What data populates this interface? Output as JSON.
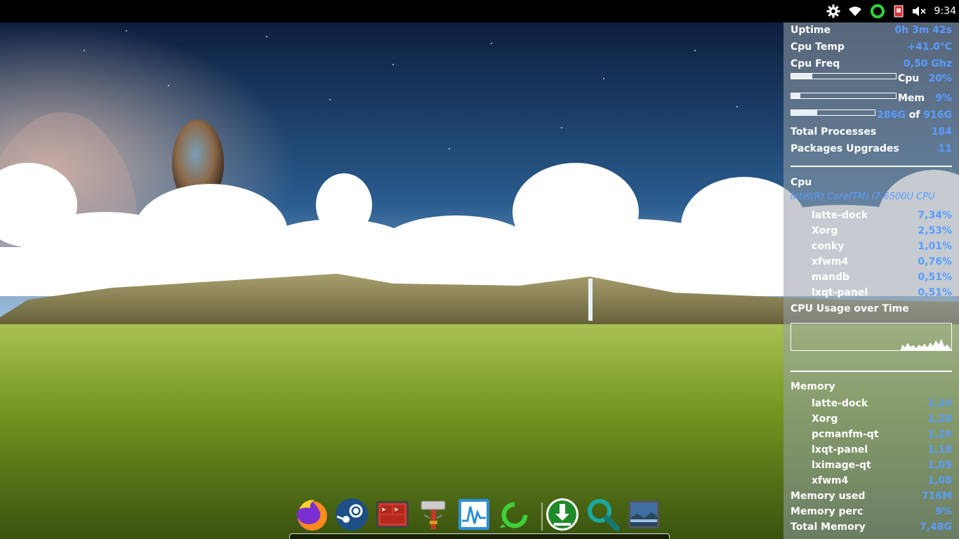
{
  "clock": "9:34",
  "tray": [
    {
      "icon": "gear-icon"
    },
    {
      "icon": "wifi-icon"
    },
    {
      "icon": "ring-status-icon"
    },
    {
      "icon": "phone-icon"
    },
    {
      "icon": "speaker-muted-icon"
    }
  ],
  "conky": {
    "uptime_label": "Uptime",
    "uptime_value": "0h 3m 42s",
    "cputemp_label": "Cpu Temp",
    "cputemp_value": "+41.0°C",
    "cpufreq_label": "Cpu Freq",
    "cpufreq_value": "0,50 Ghz",
    "cpu_bar_label": "Cpu",
    "cpu_bar_value": "20%",
    "cpu_bar_fraction": 0.2,
    "mem_bar_label": "Mem",
    "mem_bar_value": "9%",
    "mem_bar_fraction": 0.09,
    "disk_used": "286G",
    "disk_of": "of",
    "disk_total": "916G",
    "disk_fraction": 0.31,
    "processes_label": "Total Processes",
    "processes_value": "184",
    "upgrades_label": "Packages Upgrades",
    "upgrades_value": "11",
    "cpu_section": "Cpu",
    "cpu_model": "Intel(R) Core(TM) i7-6500U CPU",
    "cpu_procs": [
      {
        "name": "latte-dock",
        "value": "7,34%"
      },
      {
        "name": "Xorg",
        "value": "2,53%"
      },
      {
        "name": "conky",
        "value": "1,01%"
      },
      {
        "name": "xfwm4",
        "value": "0,76%"
      },
      {
        "name": "mandb",
        "value": "0,51%"
      },
      {
        "name": "lxqt-panel",
        "value": "0,51%"
      }
    ],
    "graph_title": "CPU Usage over Time",
    "memory_section": "Memory",
    "mem_procs": [
      {
        "name": "latte-dock",
        "value": "2,24"
      },
      {
        "name": "Xorg",
        "value": "1,28"
      },
      {
        "name": "pcmanfm-qt",
        "value": "1,26"
      },
      {
        "name": "lxqt-panel",
        "value": "1,18"
      },
      {
        "name": "lximage-qt",
        "value": "1,09"
      },
      {
        "name": "xfwm4",
        "value": "1,08"
      }
    ],
    "memused_label": "Memory used",
    "memused_value": "716M",
    "memperc_label": "Memory perc",
    "memperc_value": "9%",
    "memtotal_label": "Total Memory",
    "memtotal_value": "7,48G"
  },
  "dock": [
    {
      "icon": "firefox-icon"
    },
    {
      "icon": "steam-icon"
    },
    {
      "icon": "terminal-icon"
    },
    {
      "icon": "hammer-build-icon"
    },
    {
      "icon": "system-monitor-icon"
    },
    {
      "icon": "green-ring-app-icon"
    },
    {
      "icon": "download-icon"
    },
    {
      "icon": "search-icon"
    },
    {
      "icon": "image-viewer-icon"
    }
  ],
  "colors": {
    "accent": "#5a9cff",
    "panel": "#000000"
  }
}
